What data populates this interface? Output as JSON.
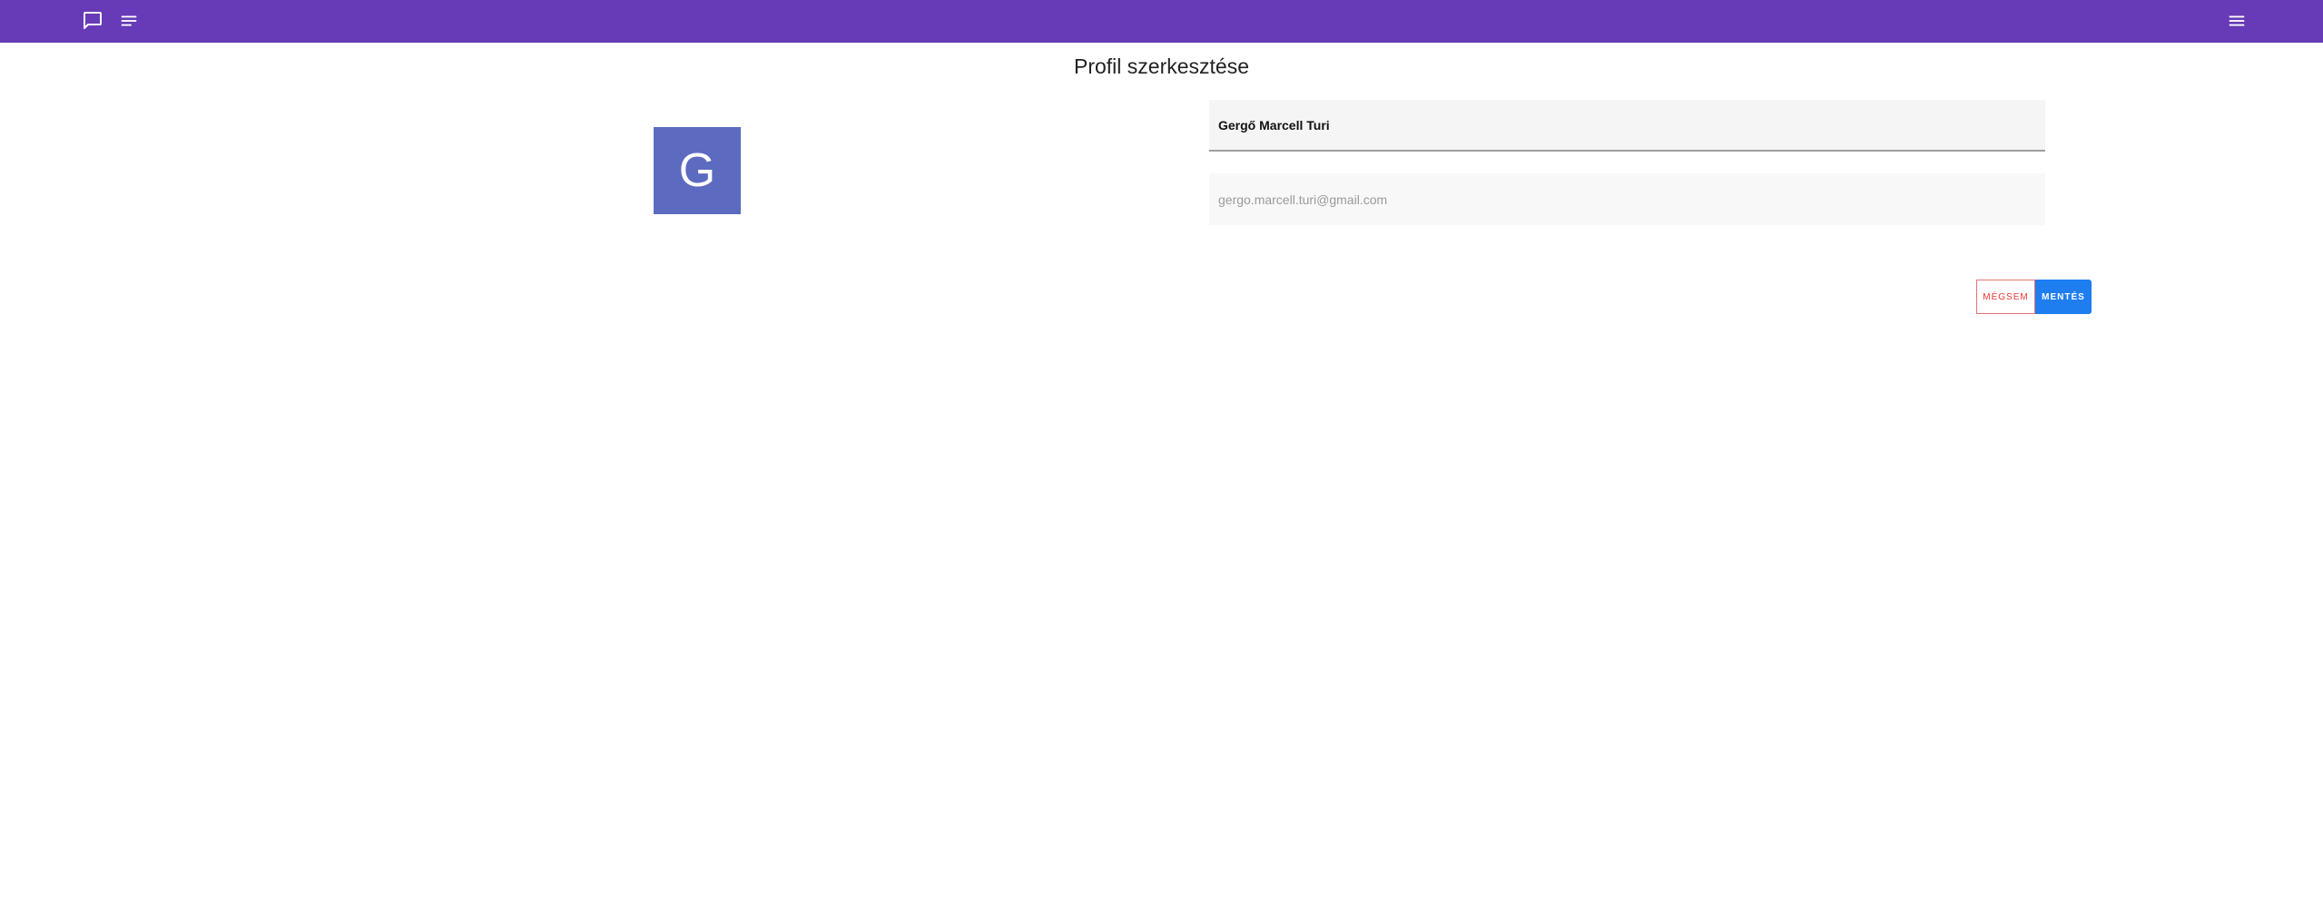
{
  "colors": {
    "topbar": "#673ab7",
    "avatar": "#5c6bc0",
    "cancel": "#e53935",
    "save": "#1e7ef0"
  },
  "topbar": {
    "left_icons": [
      "chat-bubble-icon",
      "notes-list-icon"
    ],
    "right_icons": [
      "menu-icon"
    ]
  },
  "page": {
    "title": "Profil szerkesztése"
  },
  "avatar": {
    "initial": "G"
  },
  "form": {
    "name_value": "Gergő Marcell Turi",
    "email_value": "gergo.marcell.turi@gmail.com"
  },
  "actions": {
    "cancel_label": "MÉGSEM",
    "save_label": "MENTÉS"
  }
}
